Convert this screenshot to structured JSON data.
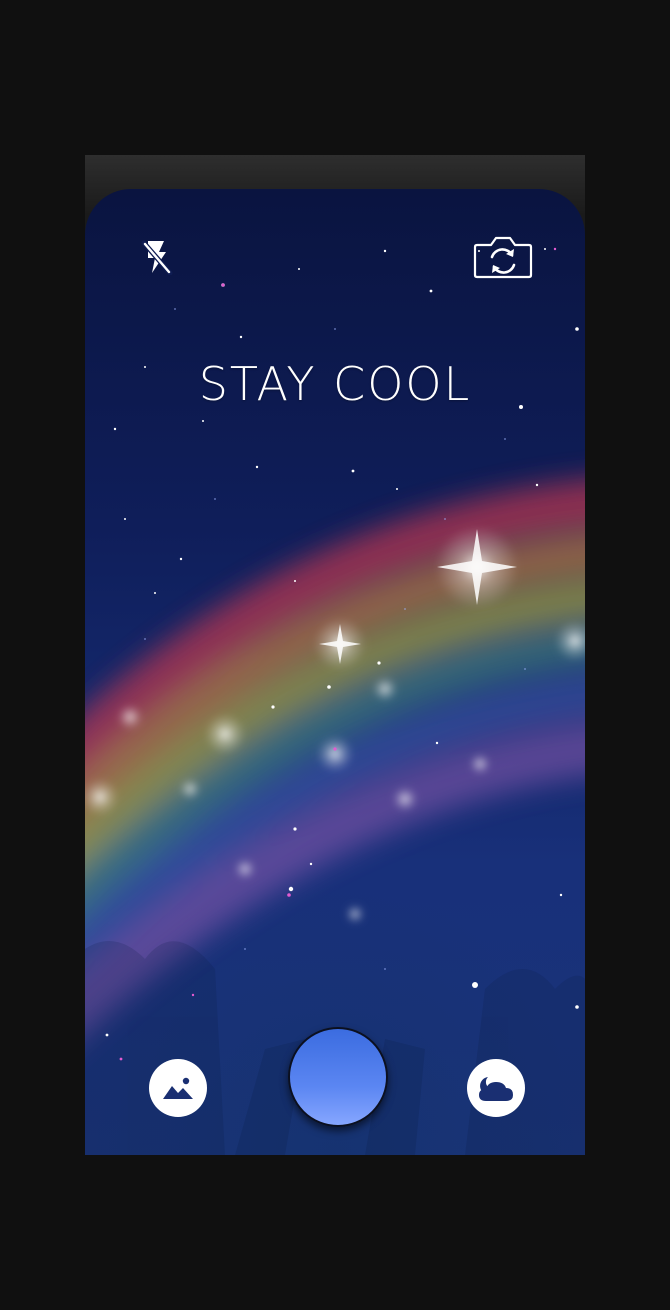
{
  "camera": {
    "headline": "STAY COOL"
  },
  "controls": {
    "flash_icon": "flash-off-icon",
    "switch_icon": "camera-switch-icon",
    "gallery_icon": "landscape-image-icon",
    "shutter_icon": "shutter-button",
    "weather_icon": "cloud-moon-icon"
  },
  "colors": {
    "background": "#101010",
    "sky_top": "#0a1440",
    "sky_bottom": "#1a3478",
    "shutter_top": "#3b6ce0",
    "shutter_bottom": "#86a6ff",
    "icon_fill": "#1a2f72"
  }
}
